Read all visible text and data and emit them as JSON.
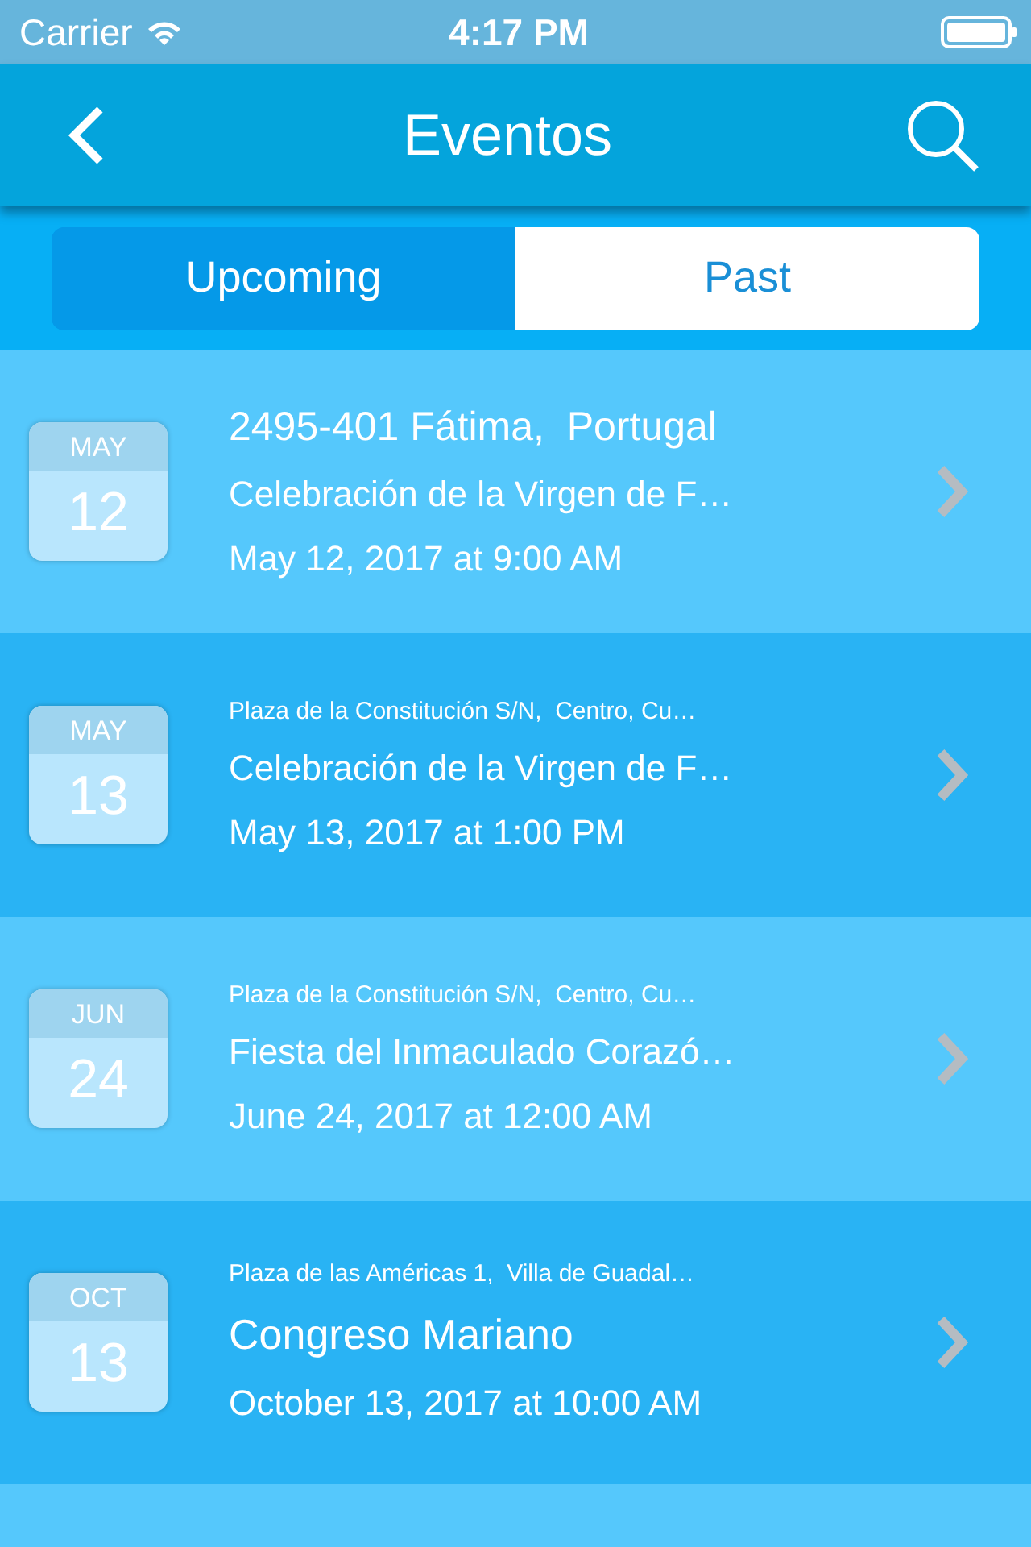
{
  "status_bar": {
    "carrier": "Carrier",
    "time": "4:17 PM"
  },
  "nav": {
    "title": "Eventos"
  },
  "tabs": [
    {
      "label": "Upcoming",
      "selected": false
    },
    {
      "label": "Past",
      "selected": true
    }
  ],
  "events": [
    {
      "month": "MAY",
      "day": "12",
      "location": "2495-401 Fátima,  Portugal",
      "title": "Celebración de la Virgen de F…",
      "date": "May 12, 2017 at 9:00 AM"
    },
    {
      "month": "MAY",
      "day": "13",
      "location": "Plaza de la Constitución S/N,  Centro, Cu…",
      "title": "Celebración de la Virgen de F…",
      "date": "May 13, 2017 at 1:00 PM"
    },
    {
      "month": "JUN",
      "day": "24",
      "location": "Plaza de la Constitución S/N,  Centro, Cu…",
      "title": "Fiesta del Inmaculado Corazó…",
      "date": "June 24, 2017 at 12:00 AM"
    },
    {
      "month": "OCT",
      "day": "13",
      "location": "Plaza de las Américas 1,  Villa de Guadal…",
      "title": "Congreso Mariano",
      "date": "October 13, 2017 at 10:00 AM"
    }
  ]
}
